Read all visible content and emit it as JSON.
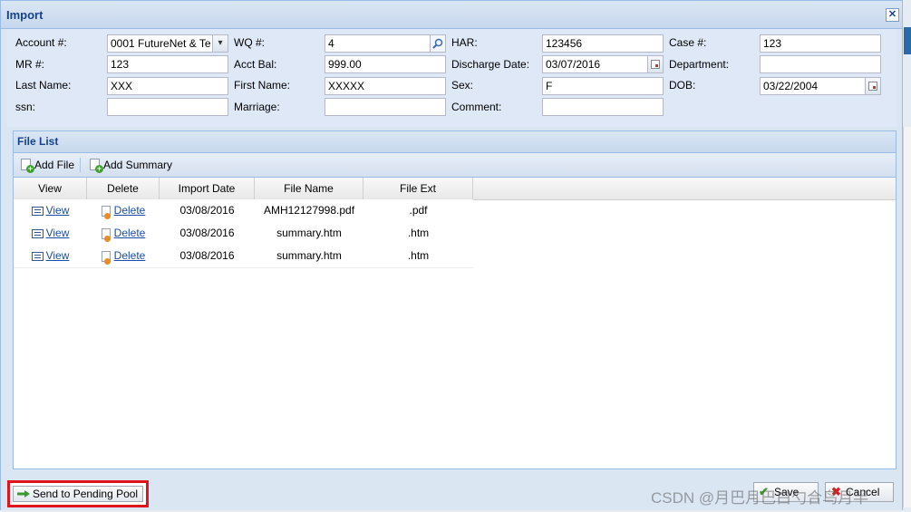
{
  "window": {
    "title": "Import"
  },
  "form": {
    "account_label": "Account #:",
    "account_value": "0001 FutureNet & Te",
    "wq_label": "WQ #:",
    "wq_value": "4",
    "har_label": "HAR:",
    "har_value": "123456",
    "case_label": "Case #:",
    "case_value": "123",
    "mr_label": "MR #:",
    "mr_value": "123",
    "acctbal_label": "Acct Bal:",
    "acctbal_value": "999.00",
    "discharge_label": "Discharge Date:",
    "discharge_value": "03/07/2016",
    "department_label": "Department:",
    "department_value": "",
    "lastname_label": "Last Name:",
    "lastname_value": "XXX",
    "firstname_label": "First Name:",
    "firstname_value": "XXXXX",
    "sex_label": "Sex:",
    "sex_value": "F",
    "dob_label": "DOB:",
    "dob_value": "03/22/2004",
    "ssn_label": "ssn:",
    "ssn_value": "",
    "marriage_label": "Marriage:",
    "marriage_value": "",
    "comment_label": "Comment:",
    "comment_value": ""
  },
  "file_list": {
    "title": "File List",
    "add_file_label": "Add File",
    "add_summary_label": "Add Summary",
    "columns": [
      "View",
      "Delete",
      "Import Date",
      "File Name",
      "File Ext"
    ],
    "rows": [
      {
        "view": "View",
        "delete": "Delete",
        "import_date": "03/08/2016",
        "file_name": "AMH12127998.pdf",
        "file_ext": ".pdf"
      },
      {
        "view": "View",
        "delete": "Delete",
        "import_date": "03/08/2016",
        "file_name": "summary.htm",
        "file_ext": ".htm"
      },
      {
        "view": "View",
        "delete": "Delete",
        "import_date": "03/08/2016",
        "file_name": "summary.htm",
        "file_ext": ".htm"
      }
    ]
  },
  "footer": {
    "send_pending_label": "Send to Pending Pool",
    "save_label": "Save",
    "cancel_label": "Cancel",
    "watermark": "CSDN @月巴月巴白勺合鸟月半"
  },
  "colors": {
    "title_text": "#15428b",
    "highlight_border": "#e0141c",
    "link": "#1a4ea8"
  }
}
